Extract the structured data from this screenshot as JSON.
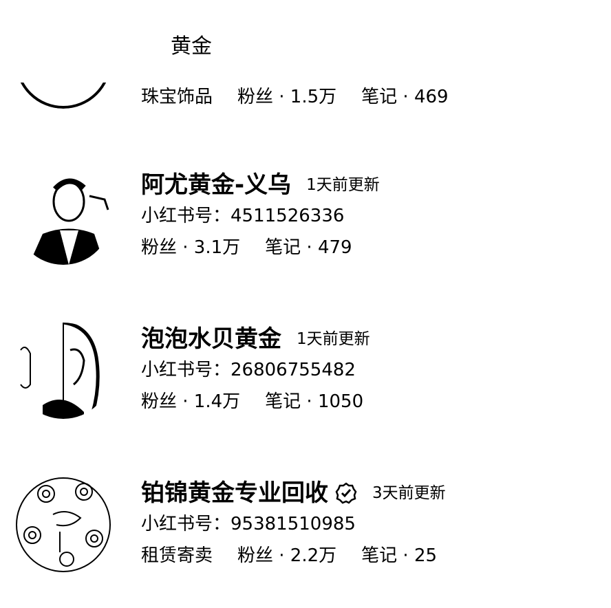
{
  "search": {
    "term": "黄金"
  },
  "accounts": [
    {
      "name": "",
      "updated": "",
      "id_label": "",
      "id": "",
      "tag": "珠宝饰品",
      "followers": "粉丝 · 1.5万",
      "notes": "笔记 · 469"
    },
    {
      "name": "阿尤黄金-义乌",
      "updated": "1天前更新",
      "id_label": "小红书号：",
      "id": "4511526336",
      "tag": "",
      "followers": "粉丝 · 3.1万",
      "notes": "笔记 · 479"
    },
    {
      "name": "泡泡水贝黄金",
      "updated": "1天前更新",
      "id_label": "小红书号：",
      "id": "26806755482",
      "tag": "",
      "followers": "粉丝 · 1.4万",
      "notes": "笔记 · 1050"
    },
    {
      "name": "铂锦黄金专业回收",
      "verified_icon": "verified-check-icon",
      "updated": "3天前更新",
      "id_label": "小红书号：",
      "id": "95381510985",
      "tag": "租赁寄卖",
      "followers": "粉丝 · 2.2万",
      "notes": "笔记 · 25"
    }
  ]
}
